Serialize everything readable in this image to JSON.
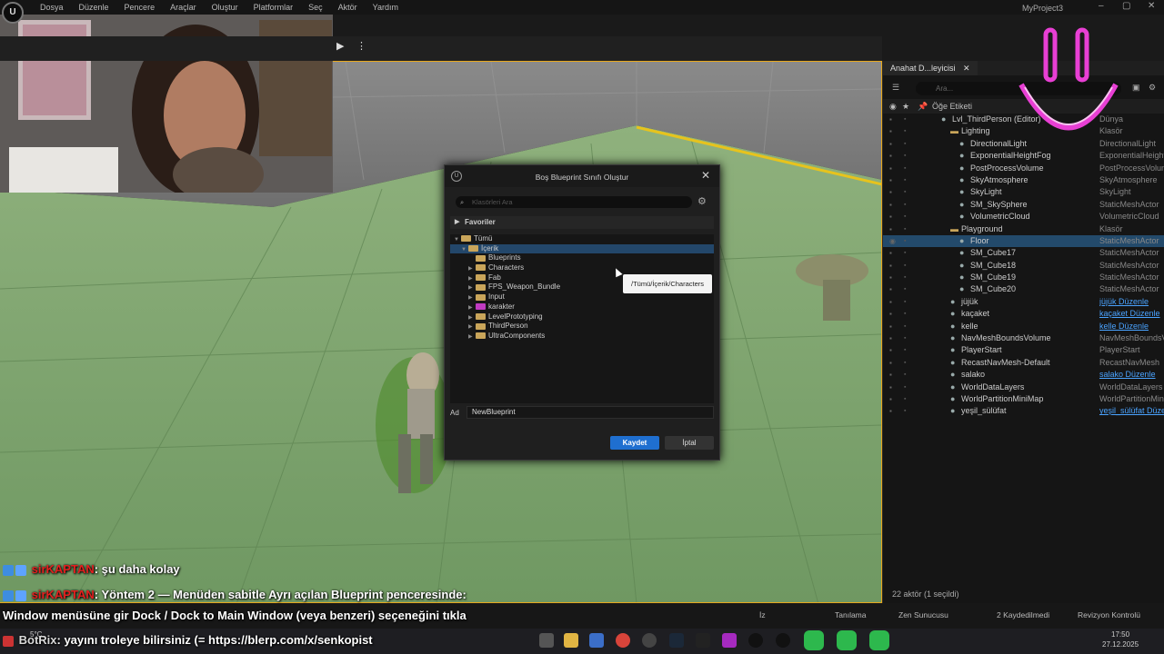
{
  "menubar": {
    "items": [
      "Dosya",
      "Düzenle",
      "Pencere",
      "Araçlar",
      "Oluştur",
      "Platformlar",
      "Seç",
      "Aktör",
      "Yardım"
    ],
    "project_name": "MyProject3",
    "window_buttons": [
      "–",
      "▢",
      "✕"
    ]
  },
  "dialog": {
    "title": "Boş Blueprint Sınıfı Oluştur",
    "search_placeholder": "Klasörleri Ara",
    "favorites_label": "Favoriler",
    "tree": [
      {
        "label": "Tümü",
        "depth": 0,
        "expanded": true
      },
      {
        "label": "İçerik",
        "depth": 1,
        "expanded": true,
        "selected": true
      },
      {
        "label": "Blueprints",
        "depth": 2
      },
      {
        "label": "Characters",
        "depth": 2,
        "hasChildren": true
      },
      {
        "label": "Fab",
        "depth": 2,
        "hasChildren": true
      },
      {
        "label": "FPS_Weapon_Bundle",
        "depth": 2,
        "hasChildren": true
      },
      {
        "label": "Input",
        "depth": 2,
        "hasChildren": true
      },
      {
        "label": "karakter",
        "depth": 2,
        "hasChildren": true,
        "color": "pink"
      },
      {
        "label": "LevelPrototyping",
        "depth": 2,
        "hasChildren": true
      },
      {
        "label": "ThirdPerson",
        "depth": 2,
        "hasChildren": true
      },
      {
        "label": "UltraComponents",
        "depth": 2,
        "hasChildren": true
      }
    ],
    "name_label": "Ad",
    "name_value": "NewBlueprint",
    "save_label": "Kaydet",
    "cancel_label": "İptal"
  },
  "tooltip": {
    "text": "/Tümü/İçerik/Characters"
  },
  "outliner": {
    "tab_title": "Anahat D...leyicisi",
    "search_placeholder": "Ara...",
    "column_label": "Öğe Etiketi",
    "rows": [
      {
        "label": "Lvl_ThirdPerson (Editor)",
        "type": "Dünya",
        "indent": 2,
        "visible": false
      },
      {
        "label": "Lighting",
        "type": "Klasör",
        "indent": 3,
        "folder": true
      },
      {
        "label": "DirectionalLight",
        "type": "DirectionalLight",
        "indent": 4
      },
      {
        "label": "ExponentialHeightFog",
        "type": "ExponentialHeight",
        "indent": 4
      },
      {
        "label": "PostProcessVolume",
        "type": "PostProcessVolum",
        "indent": 4
      },
      {
        "label": "SkyAtmosphere",
        "type": "SkyAtmosphere",
        "indent": 4
      },
      {
        "label": "SkyLight",
        "type": "SkyLight",
        "indent": 4
      },
      {
        "label": "SM_SkySphere",
        "type": "StaticMeshActor",
        "indent": 4
      },
      {
        "label": "VolumetricCloud",
        "type": "VolumetricCloud",
        "indent": 4
      },
      {
        "label": "Playground",
        "type": "Klasör",
        "indent": 3,
        "folder": true
      },
      {
        "label": "Floor",
        "type": "StaticMeshActor",
        "indent": 4,
        "selected": true,
        "visible": true
      },
      {
        "label": "SM_Cube17",
        "type": "StaticMeshActor",
        "indent": 4
      },
      {
        "label": "SM_Cube18",
        "type": "StaticMeshActor",
        "indent": 4
      },
      {
        "label": "SM_Cube19",
        "type": "StaticMeshActor",
        "indent": 4
      },
      {
        "label": "SM_Cube20",
        "type": "StaticMeshActor",
        "indent": 4
      },
      {
        "label": "jüjük",
        "type": "jüjük Düzenle",
        "indent": 3,
        "link": true
      },
      {
        "label": "kaçaket",
        "type": "kaçaket Düzenle",
        "indent": 3,
        "link": true
      },
      {
        "label": "kelle",
        "type": "kelle Düzenle",
        "indent": 3,
        "link": true
      },
      {
        "label": "NavMeshBoundsVolume",
        "type": "NavMeshBoundsVo",
        "indent": 3
      },
      {
        "label": "PlayerStart",
        "type": "PlayerStart",
        "indent": 3
      },
      {
        "label": "RecastNavMesh-Default",
        "type": "RecastNavMesh",
        "indent": 3
      },
      {
        "label": "salako",
        "type": "salako Düzenle",
        "indent": 3,
        "link": true
      },
      {
        "label": "WorldDataLayers",
        "type": "WorldDataLayers",
        "indent": 3
      },
      {
        "label": "WorldPartitionMiniMap",
        "type": "WorldPartitionMin",
        "indent": 3
      },
      {
        "label": "yeşil_sülüfat",
        "type": "yeşil_sülüfat Düzen",
        "indent": 3,
        "link": true
      }
    ],
    "footer": "22 aktör (1 seçildi)"
  },
  "bottombar": {
    "items": [
      "İz",
      "Tanılama",
      "Zen Sunucusu",
      "2 Kaydedilmedi",
      "Revizyon Kontrolü"
    ]
  },
  "chat": [
    {
      "nick": "sirKAPTAN",
      "text": ": şu daha kolay"
    },
    {
      "nick": "sirKAPTAN",
      "text": ": Yöntem 2 — Menüden sabitle Ayrı açılan Blueprint penceresinde:"
    },
    {
      "nick": "",
      "text": "Window menüsüne gir Dock / Dock to Main Window (veya benzeri) seçeneğini tıkla"
    },
    {
      "nick": "BotRix",
      "text": ": yayını troleye bilirsiniz (= https://blerp.com/x/senkopist"
    }
  ],
  "taskbar": {
    "weather": "5°C",
    "time": "17:50",
    "date": "27.12.2025"
  },
  "colors": {
    "accent": "#1f6fd0",
    "viewport_border": "#e7a81d",
    "selection": "#234a6b",
    "floor_green": "#7fa872",
    "smiley": "#e83fd4"
  }
}
